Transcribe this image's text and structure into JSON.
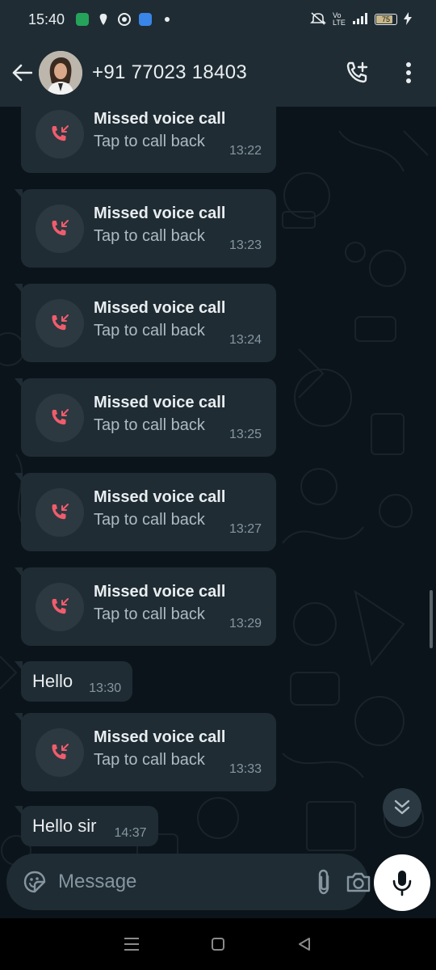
{
  "status_bar": {
    "time": "15:40",
    "battery": "75",
    "network_label": "Vo LTE"
  },
  "header": {
    "contact": "+91 77023 18403"
  },
  "messages": [
    {
      "type": "missed_call",
      "title": "Missed voice call",
      "subtitle": "Tap to call back",
      "time": "13:22"
    },
    {
      "type": "missed_call",
      "title": "Missed voice call",
      "subtitle": "Tap to call back",
      "time": "13:23"
    },
    {
      "type": "missed_call",
      "title": "Missed voice call",
      "subtitle": "Tap to call back",
      "time": "13:24"
    },
    {
      "type": "missed_call",
      "title": "Missed voice call",
      "subtitle": "Tap to call back",
      "time": "13:25"
    },
    {
      "type": "missed_call",
      "title": "Missed voice call",
      "subtitle": "Tap to call back",
      "time": "13:27"
    },
    {
      "type": "missed_call",
      "title": "Missed voice call",
      "subtitle": "Tap to call back",
      "time": "13:29"
    },
    {
      "type": "text",
      "text": "Hello",
      "time": "13:30"
    },
    {
      "type": "missed_call",
      "title": "Missed voice call",
      "subtitle": "Tap to call back",
      "time": "13:33"
    },
    {
      "type": "text",
      "text": "Hello sir",
      "time": "14:37"
    }
  ],
  "composer": {
    "placeholder": "Message"
  },
  "colors": {
    "header_bg": "#1f2c34",
    "chat_bg": "#0b141a",
    "bubble_bg": "#1f2c34",
    "missed_call_red": "#f15c6d",
    "timestamp": "#8696a0"
  }
}
